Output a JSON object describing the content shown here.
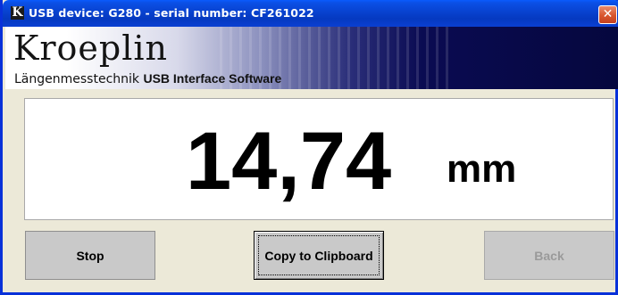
{
  "window": {
    "title": "USB device: G280  -  serial number: CF261022",
    "app_icon_glyph": "K",
    "close_glyph": "✕"
  },
  "banner": {
    "brand": "Kroeplin",
    "subtitle_part1": "Längenmesstechnik",
    "subtitle_part2": "USB Interface Software"
  },
  "measurement": {
    "value": "14,74",
    "unit": "mm"
  },
  "buttons": {
    "stop": "Stop",
    "copy": "Copy to Clipboard",
    "back": "Back"
  },
  "colors": {
    "titlebar": "#0842cf",
    "button_bg": "#c9c9c9",
    "disabled_text": "#9a9a9a"
  }
}
